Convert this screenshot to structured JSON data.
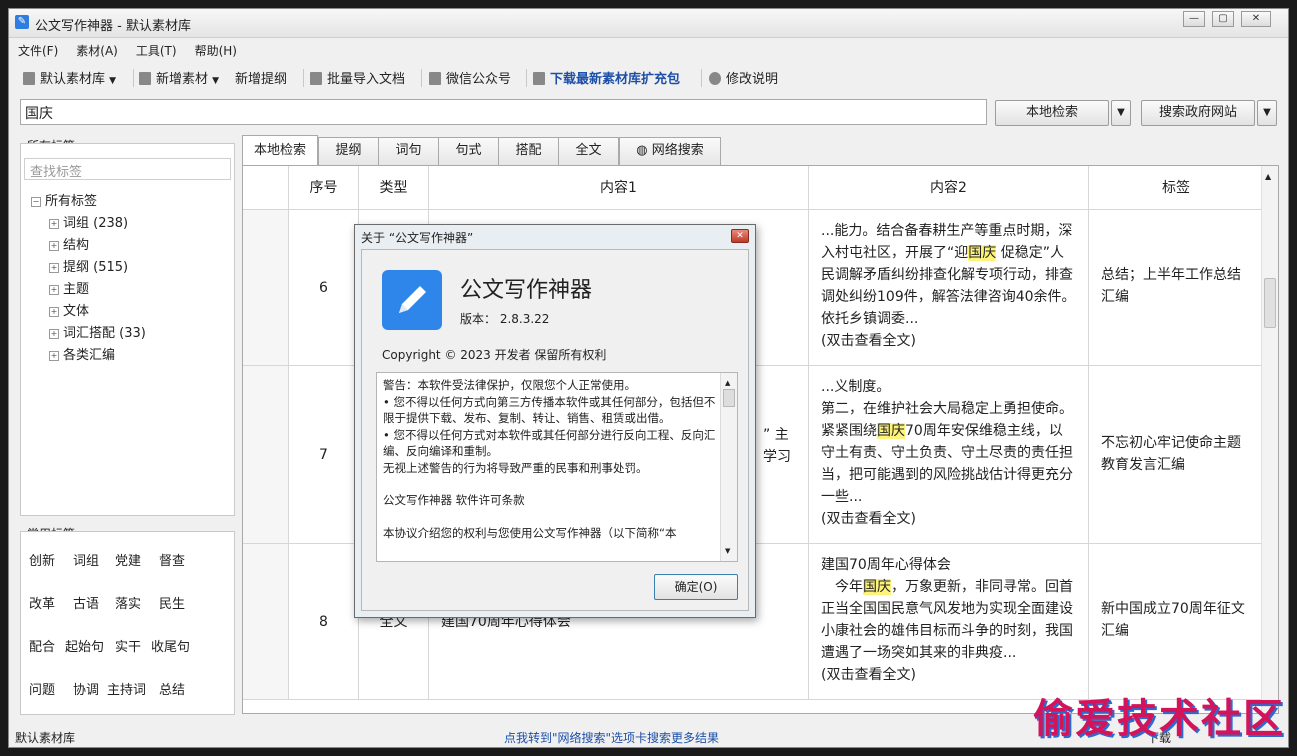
{
  "window": {
    "title": "公文写作神器  -  默认素材库"
  },
  "menu": [
    "文件(F)",
    "素材(A)",
    "工具(T)",
    "帮助(H)"
  ],
  "toolbar": {
    "library": "默认素材库",
    "add_material": "新增素材",
    "add_outline": "新增提纲",
    "batch_import": "批量导入文档",
    "wechat": "微信公众号",
    "download": "下载最新素材库扩充包",
    "changelog": "修改说明"
  },
  "search": {
    "value": "国庆",
    "local_btn": "本地检索",
    "gov_btn": "搜索政府网站"
  },
  "sidebar": {
    "all_tags_label": "所有标签",
    "search_placeholder": "查找标签",
    "root": "所有标签",
    "items": [
      "词组 (238)",
      "结构",
      "提纲 (515)",
      "主题",
      "文体",
      "词汇搭配 (33)",
      "各类汇编"
    ],
    "common_label": "常用标签",
    "common_tags": [
      "创新",
      "词组",
      "党建",
      "督查",
      "改革",
      "古语",
      "落实",
      "民生",
      "配合",
      "起始句",
      "实干",
      "收尾句",
      "问题",
      "协调",
      "主持词",
      "总结"
    ]
  },
  "tabs": [
    "本地检索",
    "提纲",
    "词句",
    "句式",
    "搭配",
    "全文",
    "网络搜索"
  ],
  "grid": {
    "headers": [
      "序号",
      "类型",
      "内容1",
      "内容2",
      "标签"
    ],
    "rows": [
      {
        "num": "6",
        "type": "",
        "c1": "",
        "c2_pre": "...能力。结合备春耕生产等重点时期，深入村屯社区，开展了“迎",
        "c2_hl": "国庆",
        "c2_post": " 促稳定”人民调解矛盾纠纷排查化解专项行动，排查调处纠纷109件，解答法律咨询40余件。依托乡镇调委...",
        "c2_more": "(双击查看全文)",
        "tag": "总结；上半年工作总结汇编"
      },
      {
        "num": "7",
        "type": "",
        "c1_frag1": "” 主",
        "c1_frag2": "学习",
        "c2_pre": "...义制度。\n第二，在维护社会大局稳定上勇担使命。紧紧围绕",
        "c2_hl": "国庆",
        "c2_post": "70周年安保维稳主线，以守土有责、守土负责、守土尽责的责任担当，把可能遇到的风险挑战估计得更充分一些...",
        "c2_more": "(双击查看全文)",
        "tag": "不忘初心牢记使命主题教育发言汇编"
      },
      {
        "num": "8",
        "type": "全文",
        "c1": "建国70周年心得体会",
        "c2_title": "建国70周年心得体会",
        "c2_pre": "　今年",
        "c2_hl": "国庆",
        "c2_post": "，万象更新，非同寻常。回首正当全国国民意气风发地为实现全面建设小康社会的雄伟目标而斗争的时刻，我国遭遇了一场突如其来的非典疫...",
        "c2_more": "(双击查看全文)",
        "tag": "新中国成立70周年征文汇编"
      }
    ]
  },
  "status": {
    "left": "默认素材库",
    "center": "点我转到\"网络搜索\"选项卡搜索更多结果",
    "right_fragment": "下载"
  },
  "dialog": {
    "title": "关于 “公文写作神器”",
    "app_name": "公文写作神器",
    "version": "版本：  2.8.3.22",
    "copyright": "Copyright © 2023  开发者 保留所有权利",
    "license": [
      "警告：本软件受法律保护，仅限您个人正常使用。",
      "•  您不得以任何方式向第三方传播本软件或其任何部分，包括但不限于提供下载、发布、复制、转让、销售、租赁或出借。",
      "•  您不得以任何方式对本软件或其任何部分进行反向工程、反向汇编、反向编译和重制。",
      "无视上述警告的行为将导致严重的民事和刑事处罚。",
      "",
      "公文写作神器 软件许可条款",
      "",
      "本协议介绍您的权利与您使用公文写作神器（以下简称“本"
    ],
    "ok": "确定(O)"
  },
  "watermark": "偷爱技术社区"
}
